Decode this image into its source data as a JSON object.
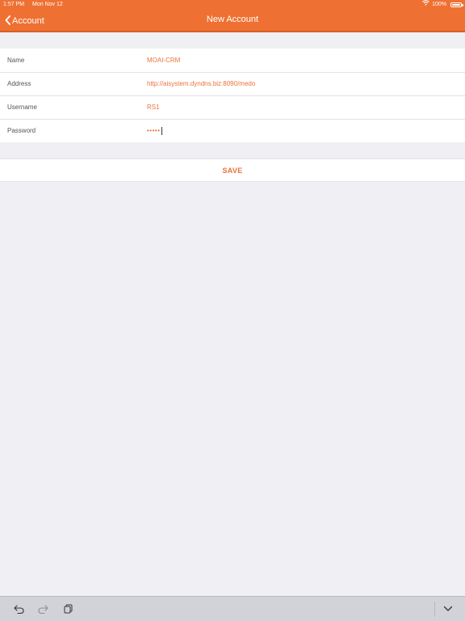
{
  "status_bar": {
    "time": "1:57 PM",
    "date": "Mon Nov 12",
    "battery": "100%"
  },
  "nav": {
    "back_label": "Account",
    "title": "New Account"
  },
  "form": {
    "fields": [
      {
        "label": "Name",
        "value": "MOAI-CRM"
      },
      {
        "label": "Address",
        "value": "http://aisystem.dyndns.biz:8090/medo"
      },
      {
        "label": "Username",
        "value": "RS1"
      },
      {
        "label": "Password",
        "value": "•••••"
      }
    ]
  },
  "save_label": "SAVE",
  "colors": {
    "accent": "#ee7133",
    "value_text": "#e8743b",
    "background": "#efeff4"
  },
  "keyboard_toolbar": {
    "icons": [
      "undo-icon",
      "redo-icon",
      "paste-icon",
      "dismiss-keyboard-icon"
    ]
  }
}
